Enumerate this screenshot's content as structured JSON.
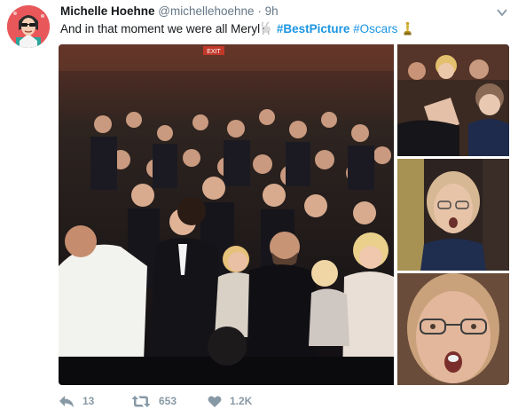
{
  "tweet": {
    "author_name": "Michelle Hoehne",
    "author_handle": "@michellehoehne",
    "separator": "·",
    "timestamp": "9h",
    "text_main": "And in that moment we were all Meryl",
    "hashtag_1": "#BestPicture",
    "hashtag_2": "#Oscars"
  },
  "media": {
    "main_photo": "audience-standing-ovation-photo",
    "thumb_1": "audience-reaction-photo",
    "thumb_2": "meryl-surprised-photo",
    "thumb_3": "meryl-closeup-photo",
    "exit_sign": "EXIT"
  },
  "actions": {
    "reply_count": "13",
    "retweet_count": "653",
    "like_count": "1.2K"
  },
  "icons": {
    "reply": "reply-icon",
    "retweet": "retweet-icon",
    "like": "heart-icon",
    "caret": "chevron-down-icon",
    "emoji_1": "goat-emoji-icon",
    "emoji_2": "oscar-statuette-icon"
  },
  "colors": {
    "link": "#1b95e0",
    "muted": "#657786",
    "action": "#8899a6",
    "avatar_bg": "#e8585a"
  }
}
